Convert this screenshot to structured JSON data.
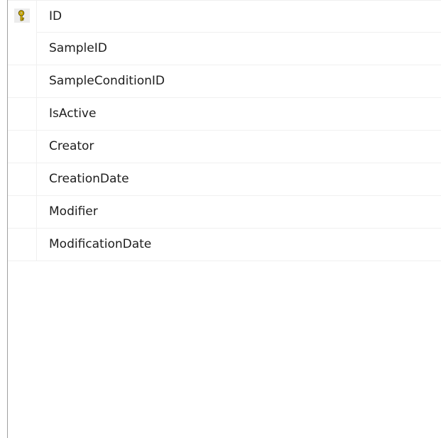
{
  "columns": [
    {
      "name": "ID",
      "primary_key": true,
      "key_icon": "key-icon"
    },
    {
      "name": "SampleID",
      "primary_key": false
    },
    {
      "name": "SampleConditionID",
      "primary_key": false
    },
    {
      "name": "IsActive",
      "primary_key": false
    },
    {
      "name": "Creator",
      "primary_key": false
    },
    {
      "name": "CreationDate",
      "primary_key": false
    },
    {
      "name": "Modifier",
      "primary_key": false
    },
    {
      "name": "ModificationDate",
      "primary_key": false
    }
  ],
  "colors": {
    "key_icon": "#d9b300",
    "gridline": "#f0f0f0",
    "border": "#a0a0a0"
  }
}
